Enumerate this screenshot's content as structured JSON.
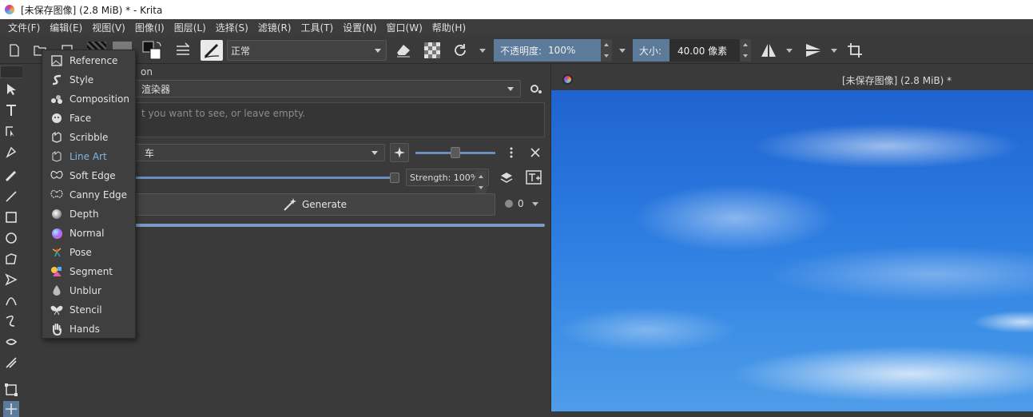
{
  "window": {
    "title": "[未保存图像]  (2.8 MiB) * - Krita"
  },
  "menubar": [
    "文件(F)",
    "编辑(E)",
    "视图(V)",
    "图像(I)",
    "图层(L)",
    "选择(S)",
    "滤镜(R)",
    "工具(T)",
    "设置(N)",
    "窗口(W)",
    "帮助(H)"
  ],
  "toolbar": {
    "blend_mode": "正常",
    "opacity_label": "不透明度:",
    "opacity_value": "100%",
    "size_label": "大小:",
    "size_value": "40.00 像素"
  },
  "docker": {
    "title_fragment": "on",
    "renderer_value": "渲染器",
    "prompt_placeholder": "t you want to see, or leave empty.",
    "control_value": "车",
    "strength_label": "Strength: 100%",
    "generate_label": "Generate",
    "seed_value": "0"
  },
  "canvas": {
    "tab_title": "[未保存图像]  (2.8 MiB) *"
  },
  "popup_menu": {
    "items": [
      {
        "label": "Reference",
        "icon": "image-icon"
      },
      {
        "label": "Style",
        "icon": "style-icon"
      },
      {
        "label": "Composition",
        "icon": "composition-icon"
      },
      {
        "label": "Face",
        "icon": "face-icon"
      },
      {
        "label": "Scribble",
        "icon": "scribble-icon"
      },
      {
        "label": "Line Art",
        "icon": "line-art-icon"
      },
      {
        "label": "Soft Edge",
        "icon": "soft-edge-icon"
      },
      {
        "label": "Canny Edge",
        "icon": "canny-edge-icon"
      },
      {
        "label": "Depth",
        "icon": "depth-icon"
      },
      {
        "label": "Normal",
        "icon": "normal-icon"
      },
      {
        "label": "Pose",
        "icon": "pose-icon"
      },
      {
        "label": "Segment",
        "icon": "segment-icon"
      },
      {
        "label": "Unblur",
        "icon": "unblur-icon"
      },
      {
        "label": "Stencil",
        "icon": "stencil-icon"
      },
      {
        "label": "Hands",
        "icon": "hands-icon"
      }
    ],
    "active_index": 5
  },
  "colors": {
    "accent": "#5c7a99",
    "active_item": "#7fb6e6",
    "progress": "#7a9cc7"
  }
}
